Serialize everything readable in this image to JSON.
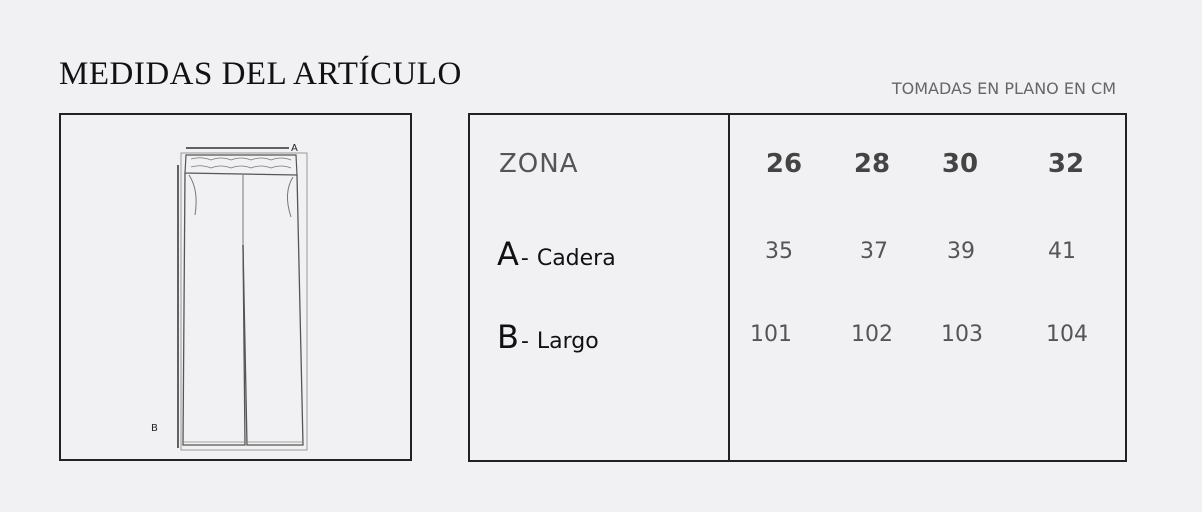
{
  "header": {
    "title": "MEDIDAS DEL ARTÍCULO",
    "subtitle": "TOMADAS EN PLANO EN CM"
  },
  "diagram": {
    "labels": {
      "a": "A",
      "b": "B"
    }
  },
  "table": {
    "zona_label": "ZONA",
    "sizes": [
      "26",
      "28",
      "30",
      "32"
    ],
    "rows": [
      {
        "letter": "A",
        "dash": "-",
        "name": "Cadera",
        "values": [
          "35",
          "37",
          "39",
          "41"
        ]
      },
      {
        "letter": "B",
        "dash": "-",
        "name": "Largo",
        "values": [
          "101",
          "102",
          "103",
          "104"
        ]
      }
    ]
  }
}
